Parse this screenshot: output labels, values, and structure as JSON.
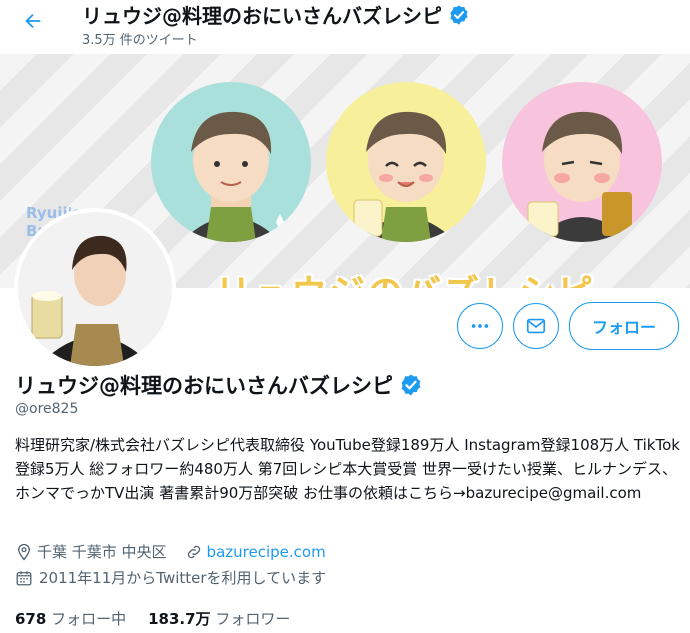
{
  "header": {
    "title": "リュウジ@料理のおにいさんバズレシピ",
    "tweet_count": "3.5万 件のツイート"
  },
  "banner": {
    "brand_line1": "Ryuji's",
    "brand_line2": "Buzz Recipe",
    "headline": "リュウジのバズレシピ"
  },
  "actions": {
    "follow_label": "フォロー"
  },
  "profile": {
    "name": "リュウジ@料理のおにいさんバズレシピ",
    "handle": "@ore825",
    "bio": "料理研究家/株式会社バズレシピ代表取締役 YouTube登録189万人 Instagram登録108万人 TikTok登録5万人 総フォロワー約480万人 第7回レシピ本大賞受賞 世界一受けたい授業、ヒルナンデス、ホンマでっかTV出演 著書累計90万部突破 お仕事の依頼はこちら→bazurecipe@gmail.com",
    "location": "千葉 千葉市 中央区",
    "website": "bazurecipe.com",
    "joined": "2011年11月からTwitterを利用しています"
  },
  "stats": {
    "following_count": "678",
    "following_label": "フォロー中",
    "followers_count": "183.7万",
    "followers_label": "フォロワー"
  },
  "colors": {
    "accent": "#1d9bf0",
    "verified": "#1d9bf0",
    "secondary_text": "#536471"
  },
  "icons": [
    "back-arrow-icon",
    "verified-badge-icon",
    "more-icon",
    "message-icon",
    "location-icon",
    "link-icon",
    "calendar-icon"
  ]
}
